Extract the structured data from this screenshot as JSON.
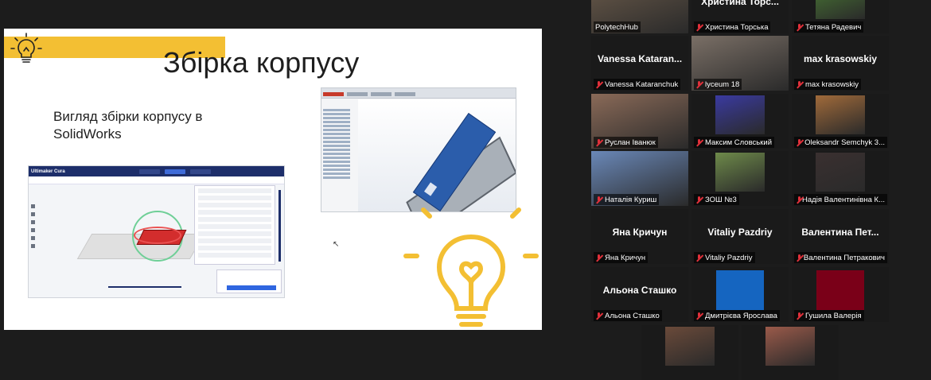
{
  "slide": {
    "title": "Збірка корпусу",
    "subtitle": "Вигляд збірки корпусу в SolidWorks",
    "cura_brand": "Ultimaker Cura"
  },
  "participants": [
    {
      "name": "PolytechHub",
      "display": "",
      "active": true,
      "kind": "video",
      "color": "#6a5a4a"
    },
    {
      "name": "Христина Торська",
      "display": "Христина Торс...",
      "kind": "name"
    },
    {
      "name": "Тетяна Радевич",
      "display": "",
      "kind": "photo",
      "color": "#4a7a34"
    },
    {
      "name": "Vanessa Kataranchuk",
      "display": "Vanessa Kataran...",
      "kind": "name"
    },
    {
      "name": "lyceum 18",
      "display": "",
      "kind": "video",
      "color": "#7a6f66"
    },
    {
      "name": "max krasowskiy",
      "display": "max krasowskiy",
      "kind": "name"
    },
    {
      "name": "Руслан Іванюк",
      "display": "",
      "kind": "video",
      "color": "#8a6a58"
    },
    {
      "name": "Максим Словський",
      "display": "",
      "kind": "photo",
      "color": "#3a3aa0"
    },
    {
      "name": "Oleksandr Semchyk 3...",
      "display": "",
      "kind": "photo",
      "color": "#a06a3a"
    },
    {
      "name": "Наталія Куриш",
      "display": "",
      "kind": "video",
      "color": "#6a88b8"
    },
    {
      "name": "ЗОШ №3",
      "display": "",
      "kind": "photo",
      "color": "#6e8a4a"
    },
    {
      "name": "Надія Валентинівна К...",
      "display": "",
      "kind": "photo",
      "color": "#3a3030"
    },
    {
      "name": "Яна Кричун",
      "display": "Яна Кричун",
      "kind": "name"
    },
    {
      "name": "Vitaliy Pazdriy",
      "display": "Vitaliy Pazdriy",
      "kind": "name"
    },
    {
      "name": "Валентина Петракович",
      "display": "Валентина Пет...",
      "kind": "name"
    },
    {
      "name": "Альона Сташко",
      "display": "Альона Сташко",
      "kind": "name"
    },
    {
      "name": "Дмитрієва Ярослава",
      "display": "",
      "kind": "swatch",
      "color": "#1565c0"
    },
    {
      "name": "Гушила Валерія",
      "display": "",
      "kind": "swatch",
      "color": "#7a0018"
    },
    {
      "name": "",
      "display": "",
      "kind": "photo",
      "color": "#6a4a3a"
    },
    {
      "name": "",
      "display": "",
      "kind": "photo",
      "color": "#9a5a4a"
    }
  ],
  "colors": {
    "accent_yellow": "#f3bf33",
    "active_border": "#b8d33a",
    "muted_mic": "#e0303a"
  }
}
